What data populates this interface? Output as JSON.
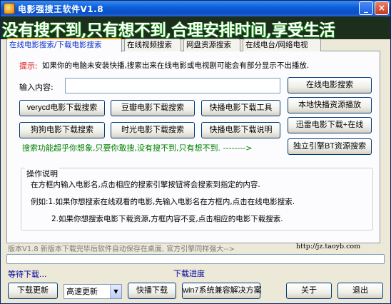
{
  "window": {
    "title": "电影强搜王软件V1.8",
    "min_label": "_",
    "close_label": "×",
    "banner": "没有搜不到,只有想不到,合理安排时间,享受生活"
  },
  "tabs": [
    {
      "label": "在线电影搜索/下载电影搜索",
      "active": true
    },
    {
      "label": "在线视频搜索",
      "active": false
    },
    {
      "label": "网盘资源搜索",
      "active": false
    },
    {
      "label": "在线电台/网络电视",
      "active": false
    }
  ],
  "hint": {
    "label": "提示:",
    "text": "如果你的电脑未安装快播,搜索出来在线电影或电视剧可能会有部分显示不出播放."
  },
  "input": {
    "label": "输入内容:",
    "value": ""
  },
  "buttons": {
    "online_search": "在线电影搜索",
    "verycd": "verycd电影下载搜索",
    "douban": "豆瓣电影下载搜索",
    "qvod_tool": "快播电影下载工具",
    "local_play": "本地快播资源播放",
    "gougou": "狗狗电影下载搜索",
    "shiguang": "时光电影下载搜索",
    "qvod_help": "快播电影下载说明",
    "xunlei": "迅雷电影下载+在线",
    "bt": "独立引擎BT资源搜索"
  },
  "green_text": "搜索功能超乎你想象,只要你敢搜,没有搜不到,只有想不到.",
  "arrow_text": "-------->",
  "guide": {
    "title": "操作说明",
    "lines": [
      "在方框内输入电影名,点击相应的搜索引擎按钮将会搜索到指定的内容.",
      "例如:1.如果你想搜索在线观看的电影,先输入电影名在方框内,点击在线电影搜索.",
      "2.如果你想搜索电影下载资源,方框内容不变,点击相应的电影下载搜索."
    ]
  },
  "version": {
    "text": "版本V1.8 新版本下载完毕后软件自动保存在桌面, 官方引擎同样强大-->",
    "link": "http://jz.taoyb.com"
  },
  "progress": {
    "value": 0
  },
  "status": {
    "left": "等待下载...",
    "mid": "下载进度"
  },
  "bottom": {
    "download_update": "下载更新",
    "select_value": "高速更新",
    "qvod_download": "快播下载",
    "win7_fix": "win7系统兼容解决方案",
    "about": "关于",
    "exit": "退出"
  },
  "colors": {
    "accent": "#0b2fc8",
    "hint": "#e00000",
    "green": "#008000",
    "status": "#0000a0"
  }
}
